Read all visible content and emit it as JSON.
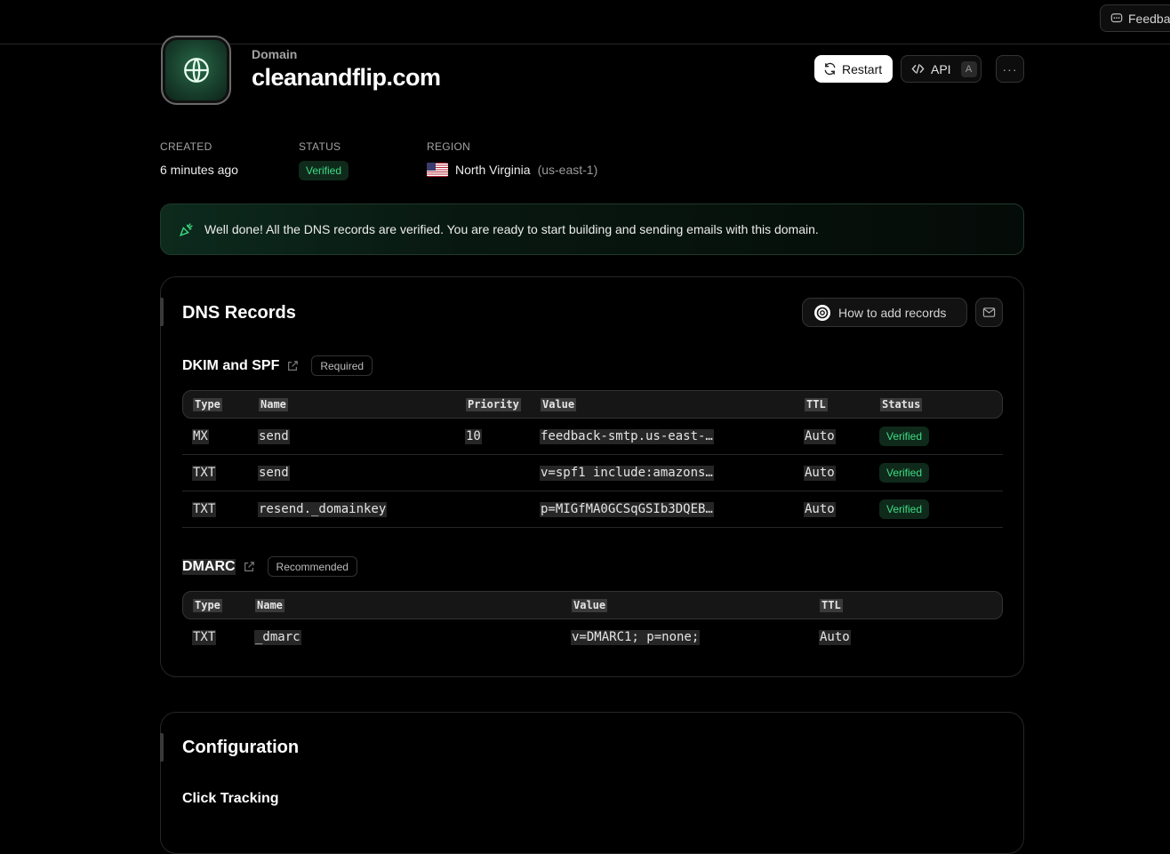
{
  "topbar": {
    "feedback_label": "Feedba"
  },
  "header": {
    "kicker": "Domain",
    "title": "cleanandflip.com",
    "restart_label": "Restart",
    "api_label": "API",
    "api_shortcut": "A",
    "more_label": "···"
  },
  "meta": {
    "created_label": "CREATED",
    "created_value": "6 minutes ago",
    "status_label": "STATUS",
    "status_value": "Verified",
    "region_label": "REGION",
    "region_name": "North Virginia",
    "region_code": "(us-east-1)"
  },
  "alert": {
    "text": "Well done! All the DNS records are verified. You are ready to start building and sending emails with this domain."
  },
  "dns": {
    "title": "DNS Records",
    "howto_label": "How to add records",
    "dkim": {
      "title": "DKIM and SPF",
      "tag": "Required",
      "headers": [
        "Type",
        "Name",
        "Priority",
        "Value",
        "TTL",
        "Status"
      ],
      "rows": [
        {
          "type": "MX",
          "name": "send",
          "priority": "10",
          "value": "feedback-smtp.us-east-…",
          "ttl": "Auto",
          "status": "Verified"
        },
        {
          "type": "TXT",
          "name": "send",
          "priority": "",
          "value": "v=spf1 include:amazons…",
          "ttl": "Auto",
          "status": "Verified"
        },
        {
          "type": "TXT",
          "name": "resend._domainkey",
          "priority": "",
          "value": "p=MIGfMA0GCSqGSIb3DQEB…",
          "ttl": "Auto",
          "status": "Verified"
        }
      ]
    },
    "dmarc": {
      "title": "DMARC",
      "tag": "Recommended",
      "headers": [
        "Type",
        "Name",
        "Value",
        "TTL"
      ],
      "rows": [
        {
          "type": "TXT",
          "name": "_dmarc",
          "value": "v=DMARC1; p=none;",
          "ttl": "Auto"
        }
      ]
    }
  },
  "config": {
    "title": "Configuration",
    "subtitle": "Click Tracking"
  },
  "colors": {
    "accent_green": "#3ddc84",
    "badge_bg": "#0f2a1b",
    "background": "#000000"
  }
}
